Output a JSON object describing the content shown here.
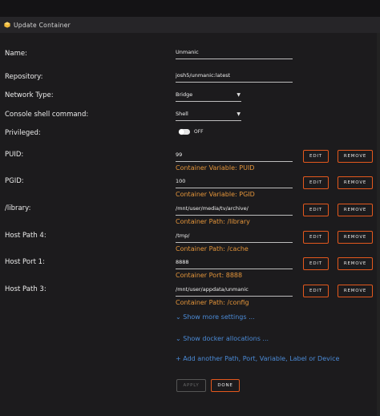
{
  "window": {
    "title": "Update Container",
    "logo_icon": "box-icon"
  },
  "fields": {
    "name": {
      "label": "Name:",
      "value": "Unmanic"
    },
    "repository": {
      "label": "Repository:",
      "value": "josh5/unmanic:latest"
    },
    "network_type": {
      "label": "Network Type:",
      "value": "Bridge"
    },
    "console_shell": {
      "label": "Console shell command:",
      "value": "Shell"
    },
    "privileged": {
      "label": "Privileged:",
      "state": "OFF"
    }
  },
  "mappings": [
    {
      "label": "PUID:",
      "value": "99",
      "hint": "Container Variable: PUID"
    },
    {
      "label": "PGID:",
      "value": "100",
      "hint": "Container Variable: PGID"
    },
    {
      "label": "/library:",
      "value": "/mnt/user/media/tv/archive/",
      "hint": "Container Path: /library"
    },
    {
      "label": "Host Path 4:",
      "value": "/tmp/",
      "hint": "Container Path: /cache"
    },
    {
      "label": "Host Port 1:",
      "value": "8888",
      "hint": "Container Port: 8888"
    },
    {
      "label": "Host Path 3:",
      "value": "/mnt/user/appdata/unmanic",
      "hint": "Container Path: /config"
    }
  ],
  "buttons": {
    "edit": "EDIT",
    "remove": "REMOVE",
    "apply": "APPLY",
    "done": "DONE"
  },
  "links": {
    "show_more": "Show more settings ...",
    "show_docker": "Show docker allocations ...",
    "add_another": "Add another Path, Port, Variable, Label or Device"
  },
  "colors": {
    "accent": "#e4581d",
    "hint": "#e4953a",
    "link": "#4b8bd7",
    "background": "#1c1b1d"
  }
}
